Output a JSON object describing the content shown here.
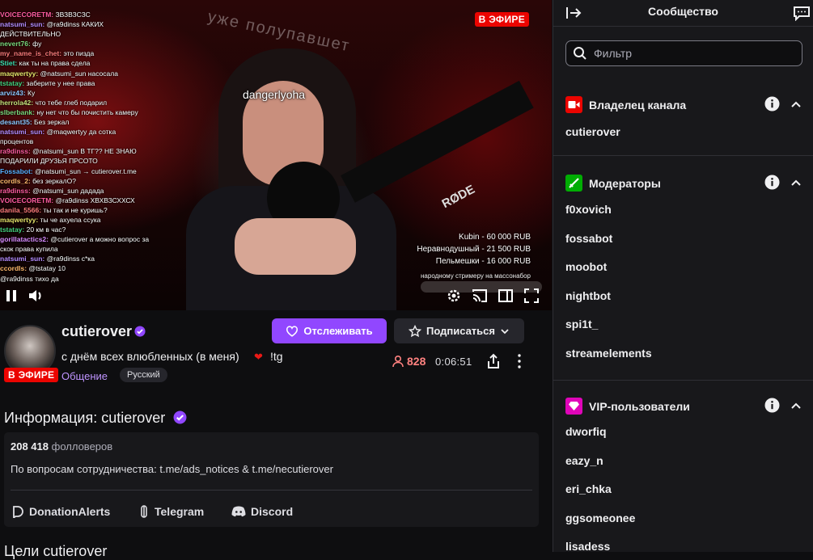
{
  "video": {
    "live_badge": "В ЭФИРЕ",
    "overlay_name": "dangerlyoha",
    "wall_text": "уже полупавшет",
    "mic_brand": "RØDE",
    "chat_overlay": [
      {
        "user": "VOICECORETM",
        "msg": "ЗВЗВЗСЗС",
        "color": "#ff5ca0"
      },
      {
        "user": "natsumi_sun",
        "msg": "@ra9dinss КАКИХ",
        "color": "#b58cff"
      },
      {
        "user": "",
        "msg": "ДЕЙСТВИТЕЛЬНО",
        "color": "#ffffff"
      },
      {
        "user": "nevert76",
        "msg": "фу",
        "color": "#7cd87c"
      },
      {
        "user": "my_name_is_chet",
        "msg": "это пизда",
        "color": "#ff7b7b"
      },
      {
        "user": "Stiet",
        "msg": "как ты на права сдела",
        "color": "#3fe0b0"
      },
      {
        "user": "maqwertyy",
        "msg": "@natsumi_sun насосала",
        "color": "#e6e36a"
      },
      {
        "user": "tstatay",
        "msg": "заберите у нее права",
        "color": "#46d27f"
      },
      {
        "user": "arviz43",
        "msg": "Ку",
        "color": "#8fc7ff"
      },
      {
        "user": "herrola42",
        "msg": "что тебе глеб подарил",
        "color": "#c6e07a"
      },
      {
        "user": "slberbank",
        "msg": "ну нет что бы почистить камеру",
        "color": "#7cd87c"
      },
      {
        "user": "desant35",
        "msg": "Без зеркал",
        "color": "#8fc7ff"
      },
      {
        "user": "natsumi_sun",
        "msg": "@maqwertyy да сотка",
        "color": "#b58cff"
      },
      {
        "user": "",
        "msg": "процентов",
        "color": "#ffffff"
      },
      {
        "user": "ra9dinss",
        "msg": "@natsumi_sun В ТГ?? НЕ ЗНАЮ",
        "color": "#ff5ca0"
      },
      {
        "user": "",
        "msg": "ПОДАРИЛИ ДРУЗЬЯ ПРСОТО",
        "color": "#ffffff"
      },
      {
        "user": "Fossabot",
        "msg": "@natsumi_sun → cutierover.t.me",
        "color": "#5ab0ff"
      },
      {
        "user": "cordls_2",
        "msg": "без зеркалО?",
        "color": "#ffb86c"
      },
      {
        "user": "ra9dinss",
        "msg": "@natsumi_sun дадада",
        "color": "#ff5ca0"
      },
      {
        "user": "VOICECORETM",
        "msg": "@ra9dinss ХВХВЗСХХСХ",
        "color": "#ff5ca0"
      },
      {
        "user": "danila_5566",
        "msg": "ты так и не куришь?",
        "color": "#ff7b7b"
      },
      {
        "user": "maqwertyy",
        "msg": "ты че ахуела ссука",
        "color": "#e6e36a"
      },
      {
        "user": "tstatay",
        "msg": "20 км в час?",
        "color": "#46d27f"
      },
      {
        "user": "gorillatactics2",
        "msg": "@cutierover а можно вопрос за",
        "color": "#d98cff"
      },
      {
        "user": "",
        "msg": "скок права купила",
        "color": "#ffffff"
      },
      {
        "user": "natsumi_sun",
        "msg": "@ra9dinss с*ка",
        "color": "#b58cff"
      },
      {
        "user": "ccordls",
        "msg": "@tstatay 10",
        "color": "#ffb86c"
      },
      {
        "user": "",
        "msg": "@ra9dinss тихо да",
        "color": "#ffffff"
      }
    ],
    "donations": [
      "Kubin - 60 000 RUB",
      "Неравнодушный - 21 500 RUB",
      "Пельмешки - 16 000 RUB"
    ],
    "donation_note": "народному стримеру на массонабор"
  },
  "channel": {
    "name": "cutierover",
    "live_badge": "В ЭФИРЕ",
    "title": "с днём всех влюбленных (в меня)",
    "title_emoji": "❤",
    "title_tag": "!tg",
    "category": "Общение",
    "language": "Русский",
    "follow_label": "Отслеживать",
    "subscribe_label": "Подписаться",
    "viewers": "828",
    "uptime": "0:06:51"
  },
  "about": {
    "title": "Информация: cutierover",
    "followers_count": "208 418",
    "followers_label": "фолловеров",
    "description": "По вопросам сотрудничества: t.me/ads_notices & t.me/necutierover",
    "links": [
      "DonationAlerts",
      "Telegram",
      "Discord"
    ],
    "goals_title": "Цели cutierover"
  },
  "community": {
    "title": "Сообщество",
    "filter_placeholder": "Фильтр",
    "sections": [
      {
        "title": "Владелец канала",
        "color": "#eb0400",
        "members": [
          "cutierover"
        ]
      },
      {
        "title": "Модераторы",
        "color": "#00ad03",
        "members": [
          "f0xovich",
          "fossabot",
          "moobot",
          "nightbot",
          "spi1t_",
          "streamelements"
        ]
      },
      {
        "title": "VIP-пользователи",
        "color": "#e005b9",
        "members": [
          "dworfiq",
          "eazy_n",
          "eri_chka",
          "ggsomeonee",
          "lisadess"
        ]
      }
    ]
  },
  "colors": {
    "accent": "#9147ff",
    "live": "#eb0400",
    "viewers": "#ff8280",
    "category": "#bf94ff"
  }
}
